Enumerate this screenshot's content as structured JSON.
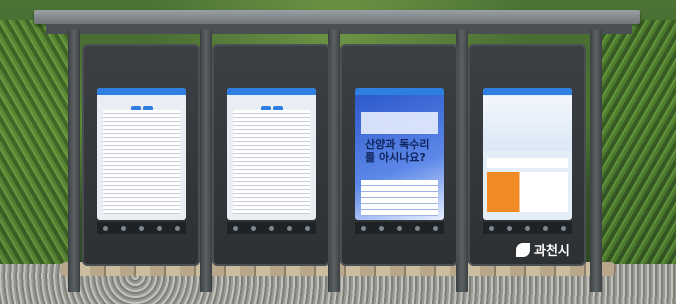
{
  "scene": {
    "description_type": "photo",
    "logo_text": "과천시",
    "promo_headline": "산양과 독수리를 아시나요?",
    "colors": {
      "accent_blue": "#2f7fe0",
      "frame": "#2d3033",
      "roof": "#8a9094",
      "foliage": "#4d7335",
      "gravel": "#b0b0aa"
    }
  },
  "kiosks": [
    {
      "id": 1,
      "content": "document"
    },
    {
      "id": 2,
      "content": "document"
    },
    {
      "id": 3,
      "content": "promotion"
    },
    {
      "id": 4,
      "content": "information"
    }
  ]
}
